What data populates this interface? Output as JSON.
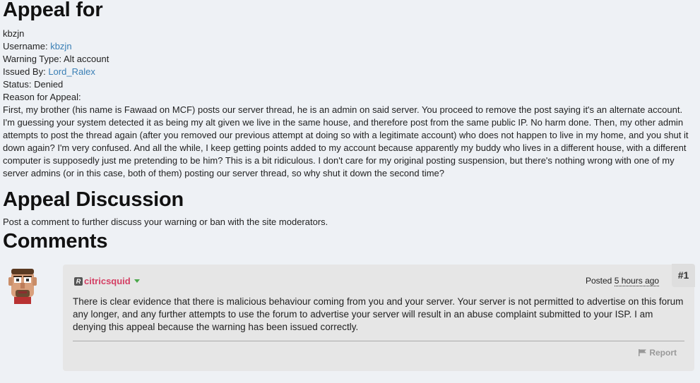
{
  "appeal": {
    "title": "Appeal for",
    "name": "kbzjn",
    "username_label": "Username:",
    "username_value": "kbzjn",
    "warning_label": "Warning Type:",
    "warning_value": "Alt account",
    "issued_label": "Issued By:",
    "issued_value": "Lord_Ralex",
    "status_label": "Status:",
    "status_value": "Denied",
    "reason_label": "Reason for Appeal:",
    "reason_text": "First, my brother (his name is Fawaad on MCF) posts our server thread, he is an admin on said server. You proceed to remove the post saying it's an alternate account. I'm guessing your system detected it as being my alt given we live in the same house, and therefore post from the same public IP. No harm done. Then, my other admin attempts to post the thread again (after you removed our previous attempt at doing so with a legitimate account) who does not happen to live in my home, and you shut it down again? I'm very confused. And all the while, I keep getting points added to my account because apparently my buddy who lives in a different house, with a different computer is supposedly just me pretending to be him? This is a bit ridiculous. I don't care for my original posting suspension, but there's nothing wrong with one of my server admins (or in this case, both of them) posting our server thread, so why shut it down the second time?"
  },
  "discussion": {
    "title": "Appeal Discussion",
    "subtitle": "Post a comment to further discuss your warning or ban with the site moderators."
  },
  "comments": {
    "title": "Comments",
    "items": [
      {
        "author": "citricsquid",
        "rank_icon": "R",
        "posted_label": "Posted",
        "posted_ago": "5 hours ago",
        "number": "#1",
        "text": "There is clear evidence that there is malicious behaviour coming from you and your server. Your server is not permitted to advertise on this forum any longer, and any further attempts to use the forum to advertise your server will result in an abuse complaint submitted to your ISP. I am denying this appeal because the warning has been issued correctly.",
        "report_label": "Report",
        "author_color": "#d43f64"
      }
    ]
  },
  "colors": {
    "link": "#3a7fb5",
    "background": "#eef1f5",
    "post_box": "#e6e6e6"
  }
}
